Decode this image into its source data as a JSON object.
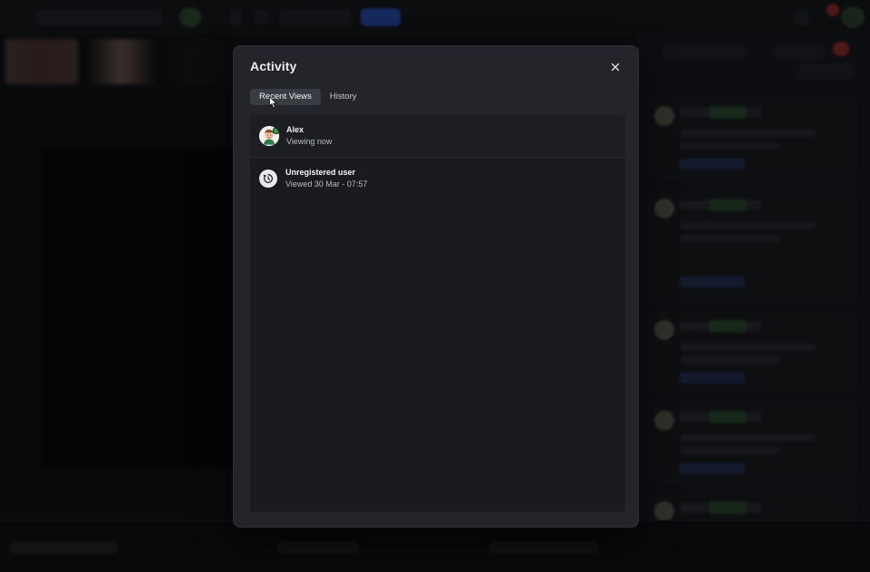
{
  "modal": {
    "title": "Activity",
    "tabs": [
      {
        "label": "Recent Views",
        "active": true
      },
      {
        "label": "History",
        "active": false
      }
    ],
    "rows": [
      {
        "name": "Alex",
        "meta": "Viewing now",
        "avatar_icon": "user-avatar-icon",
        "online": true
      },
      {
        "name": "Unregistered user",
        "meta": "Viewed 30 Mar - 07:57",
        "avatar_icon": "history-clock-icon",
        "online": false
      }
    ]
  },
  "colors": {
    "overlay": "#000000",
    "modal_bg": "#24252a",
    "panel_bg": "#1a1b1f",
    "accent_blue": "#2d5edb",
    "online_green": "#2ea44f"
  }
}
